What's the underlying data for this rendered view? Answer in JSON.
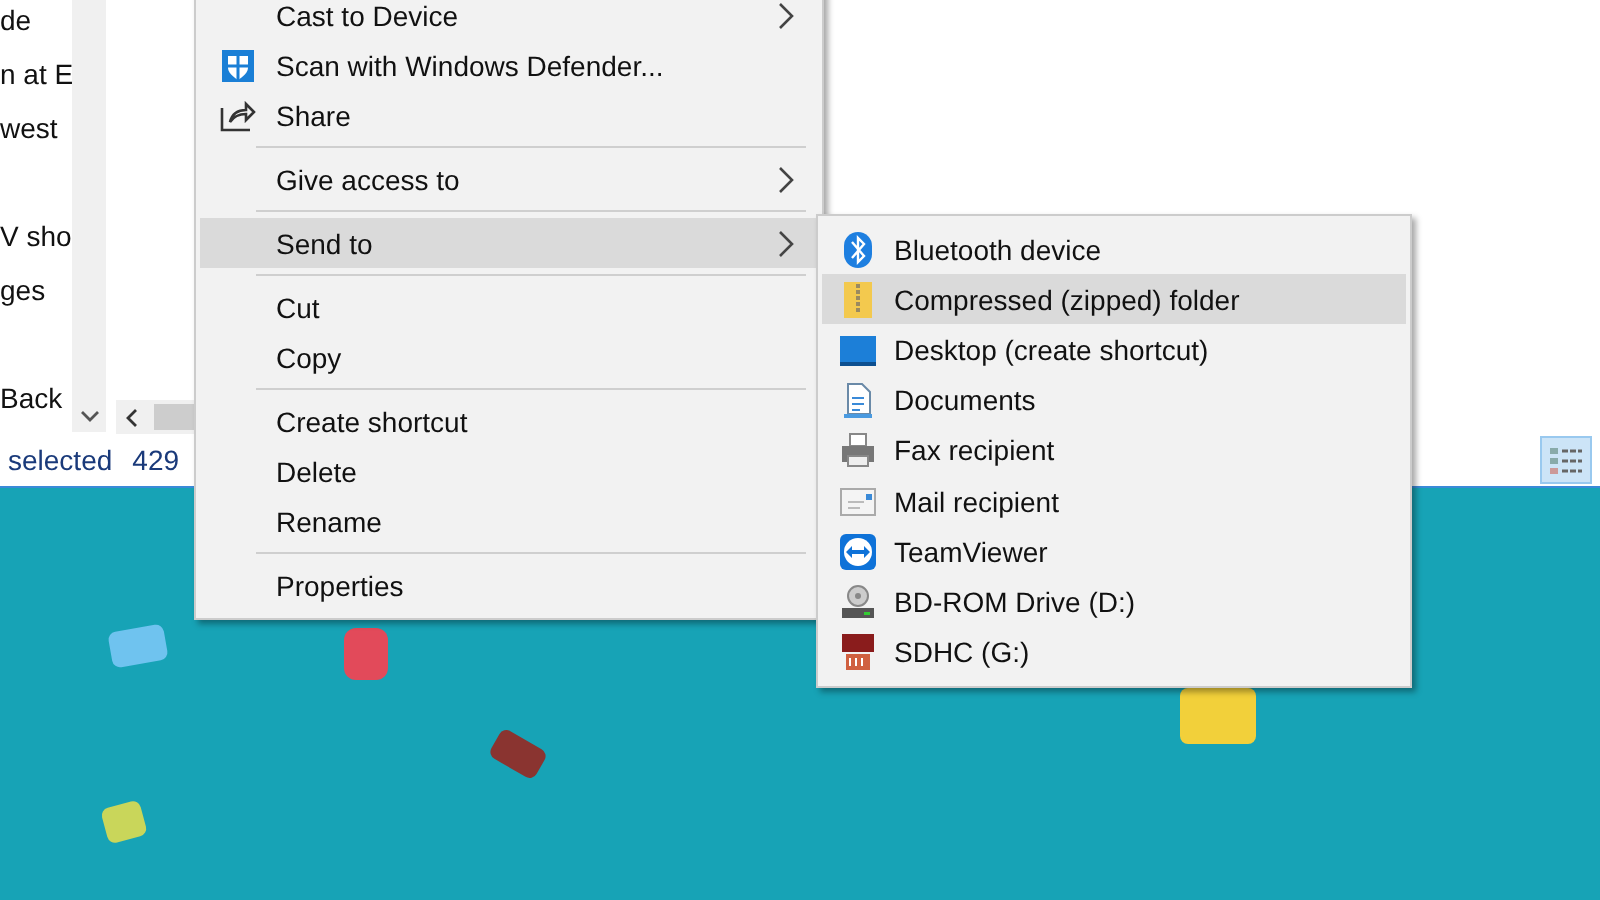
{
  "file_list": {
    "items": [
      "de",
      "n at E",
      "west",
      "V sho",
      "ges",
      "Back"
    ]
  },
  "status_bar": {
    "selection": "selected",
    "size": "429"
  },
  "context_menu": {
    "items": [
      {
        "kind": "item",
        "label": "Cast to Device",
        "submenu": true,
        "selected": false
      },
      {
        "kind": "item",
        "label": "Scan with Windows Defender...",
        "submenu": false,
        "selected": false
      },
      {
        "kind": "item",
        "label": "Share",
        "submenu": false,
        "selected": false
      },
      {
        "kind": "separator"
      },
      {
        "kind": "item",
        "label": "Give access to",
        "submenu": true,
        "selected": false
      },
      {
        "kind": "separator"
      },
      {
        "kind": "item",
        "label": "Send to",
        "submenu": true,
        "selected": true
      },
      {
        "kind": "separator"
      },
      {
        "kind": "item",
        "label": "Cut",
        "submenu": false,
        "selected": false
      },
      {
        "kind": "item",
        "label": "Copy",
        "submenu": false,
        "selected": false
      },
      {
        "kind": "separator"
      },
      {
        "kind": "item",
        "label": "Create shortcut",
        "submenu": false,
        "selected": false
      },
      {
        "kind": "item",
        "label": "Delete",
        "submenu": false,
        "selected": false
      },
      {
        "kind": "item",
        "label": "Rename",
        "submenu": false,
        "selected": false
      },
      {
        "kind": "separator"
      },
      {
        "kind": "item",
        "label": "Properties",
        "submenu": false,
        "selected": false
      }
    ]
  },
  "send_to_menu": {
    "items": [
      {
        "label": "Bluetooth device",
        "selected": false
      },
      {
        "label": "Compressed (zipped) folder",
        "selected": true
      },
      {
        "label": "Desktop (create shortcut)",
        "selected": false
      },
      {
        "label": "Documents",
        "selected": false
      },
      {
        "label": "Fax recipient",
        "selected": false
      },
      {
        "label": "Mail recipient",
        "selected": false
      },
      {
        "label": "TeamViewer",
        "selected": false
      },
      {
        "label": "BD-ROM Drive (D:)",
        "selected": false
      },
      {
        "label": "SDHC (G:)",
        "selected": false
      }
    ]
  }
}
